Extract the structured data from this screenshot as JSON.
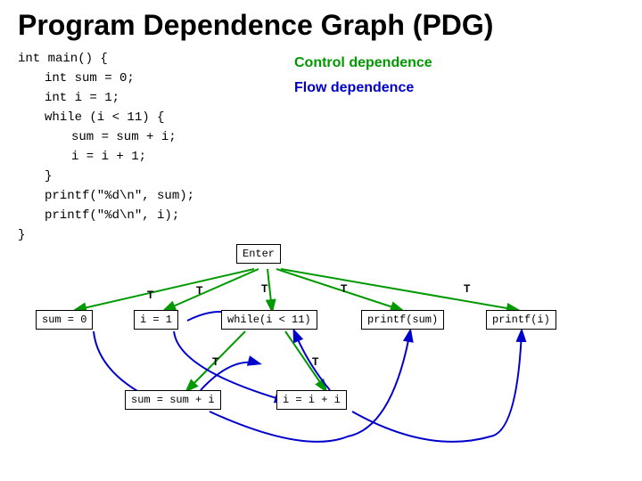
{
  "title": "Program Dependence Graph (PDG)",
  "code_lines": [
    "int main() {",
    "      int sum = 0;",
    "      int i = 1;",
    "      while (i < 11) {",
    "            sum = sum + i;",
    "            i = i + 1;",
    "      }",
    "      printf(\"%d\\n\", sum);",
    "      printf(\"%d\\n\", i);",
    "}"
  ],
  "legend": {
    "control_label": "Control dependence",
    "flow_label": "Flow dependence"
  },
  "nodes": {
    "enter": "Enter",
    "sum0": "sum = 0",
    "i1": "i = 1",
    "while": "while(i < 11)",
    "printf_sum": "printf(sum)",
    "printf_i": "printf(i)",
    "sum_expr": "sum = sum + i",
    "i_expr": "i = i + i"
  }
}
